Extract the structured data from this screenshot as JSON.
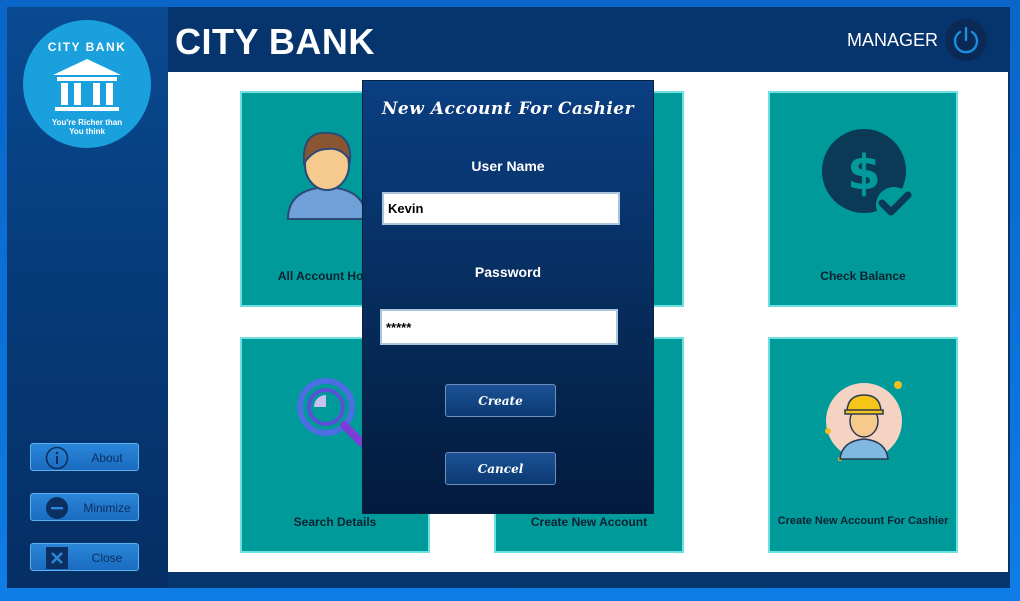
{
  "app": {
    "title": "CITY BANK",
    "role": "MANAGER"
  },
  "logo": {
    "name": "CITY BANK",
    "tagline_line1": "You're Richer than",
    "tagline_line2": "You think"
  },
  "sidebar": {
    "about_label": "About",
    "minimize_label": "Minimize",
    "close_label": "Close"
  },
  "tiles": [
    {
      "label": "All Account Holders",
      "icon": "person-icon"
    },
    {
      "label": "",
      "icon": ""
    },
    {
      "label": "Check Balance",
      "icon": "dollar-check-icon"
    },
    {
      "label": "Search Details",
      "icon": "magnifier-icon"
    },
    {
      "label": "Create New Account",
      "icon": ""
    },
    {
      "label": "Create New Account For Cashier",
      "icon": "worker-icon"
    }
  ],
  "dialog": {
    "title": "New Account For Cashier",
    "username_label": "User Name",
    "username_value": "Kevin",
    "password_label": "Password",
    "password_value": "*****",
    "create_label": "Create",
    "cancel_label": "Cancel"
  },
  "colors": {
    "tile": "#019a9a",
    "tile_border": "#6fe0e0",
    "sidebar": "#063a78",
    "frame": "#0b6bd3"
  }
}
